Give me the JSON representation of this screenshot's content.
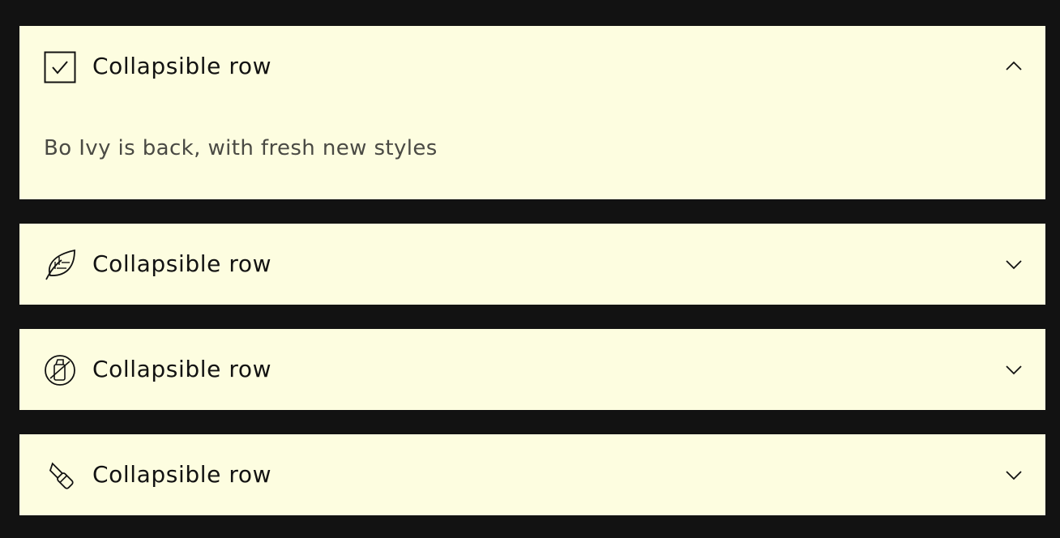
{
  "rows": [
    {
      "title": "Collapsible row",
      "icon": "check-box-icon",
      "expanded": true,
      "content": "Bo Ivy is back, with fresh new styles"
    },
    {
      "title": "Collapsible row",
      "icon": "leaf-icon",
      "expanded": false
    },
    {
      "title": "Collapsible row",
      "icon": "bottle-icon",
      "expanded": false
    },
    {
      "title": "Collapsible row",
      "icon": "lipstick-icon",
      "expanded": false
    }
  ],
  "colors": {
    "page_background": "#121212",
    "row_background": "#fdfde0",
    "text": "#121212",
    "content_text": "#4a4a44"
  }
}
